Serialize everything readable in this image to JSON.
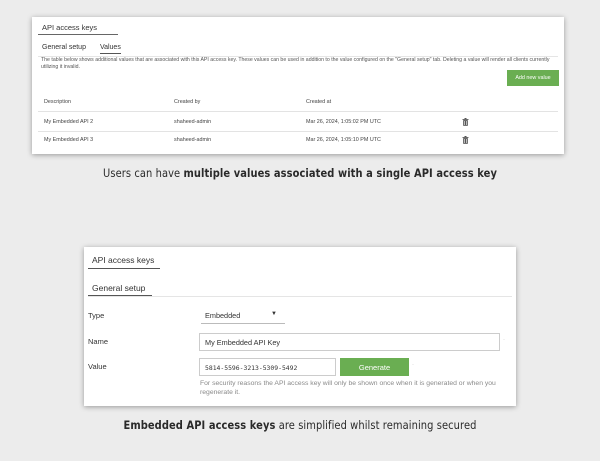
{
  "values_panel": {
    "title": "API access keys",
    "tabs": [
      {
        "label": "General setup",
        "active": false
      },
      {
        "label": "Values",
        "active": true
      }
    ],
    "description": "The table below shows additional values that are associated with this API access key. These values can be used in addition to the value configured on the \"General setup\" tab. Deleting a value will render all clients currently utilizing it invalid.",
    "add_button_label": "Add new value",
    "columns": [
      "Description",
      "Created by",
      "Created at"
    ],
    "rows": [
      {
        "description": "My Embedded API 2",
        "created_by": "shaheed-admin",
        "created_at": "Mar 26, 2024, 1:05:02 PM UTC"
      },
      {
        "description": "My Embedded API 3",
        "created_by": "shaheed-admin",
        "created_at": "Mar 26, 2024, 1:05:10 PM UTC"
      }
    ],
    "delete_icon": "trash-icon"
  },
  "caption_top": {
    "pre": "Users can have ",
    "bold": "multiple values associated with a single API access key",
    "post": ""
  },
  "general_panel": {
    "title": "API access keys",
    "tab_label": "General setup",
    "type_label": "Type",
    "type_value": "Embedded",
    "name_label": "Name",
    "name_value": "My Embedded API Key",
    "value_label": "Value",
    "value_value": "5814-5596-3213-5309-5492",
    "generate_label": "Generate",
    "hint": "For security reasons the API access key will only be shown once when it is generated or when you regenerate it."
  },
  "caption_bottom": {
    "bold": "Embedded API access keys",
    "post": " are simplified whilst remaining secured"
  },
  "colors": {
    "accent_green": "#6aae52",
    "background": "#ececec"
  }
}
